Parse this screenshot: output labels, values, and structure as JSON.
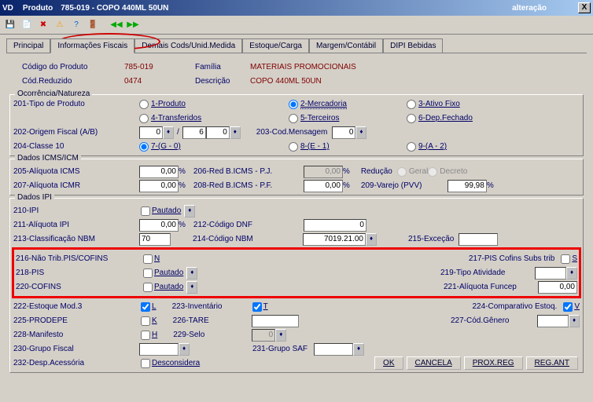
{
  "title": {
    "app": "VD",
    "mod": "Produto",
    "code": "785-019 - COPO 440ML 50UN",
    "mode": "alteração",
    "close": "X"
  },
  "tabs": {
    "t0": "Principal",
    "t1": "Informações Fiscais",
    "t2": "Demais Cods/Unid.Medida",
    "t3": "Estoque/Carga",
    "t4": "Margem/Contábil",
    "t5": "DIPI Bebidas"
  },
  "hdr": {
    "l1": "Código do Produto",
    "v1": "785-019",
    "l2": "Família",
    "v2": "MATERIAIS PROMOCIONAIS",
    "l3": "Cód.Reduzido",
    "v3": "0474",
    "l4": "Descrição",
    "v4": "COPO 440ML 50UN"
  },
  "g1": {
    "title": "Ocorrência/Natureza",
    "f201": "201-Tipo de Produto",
    "o1": "1-Produto",
    "o2": "2-Mercadoria",
    "o3": "3-Ativo Fixo",
    "o4": "4-Transferidos",
    "o5": "5-Terceiros",
    "o6": "6-Dep.Fechado",
    "f202": "202-Origem Fiscal (A/B)",
    "v202a": "0",
    "v202b": "6",
    "v202c": "0",
    "f203": "203-Cod.Mensagem",
    "v203": "0",
    "f204": "204-Classe 10",
    "o7": "7-(G - 0)",
    "o8": "8-(E - 1)",
    "o9": "9-(A - 2)"
  },
  "g2": {
    "title": "Dados ICMS/ICM",
    "f205": "205-Alíquota ICMS",
    "v205": "0,00",
    "pct": "%",
    "f206": "206-Red B.ICMS - P.J.",
    "v206": "0,00",
    "fr": "Redução",
    "og": "Geral",
    "od": "Decreto",
    "f207": "207-Alíquota ICMR",
    "v207": "0,00",
    "f208": "208-Red B.ICMS - P.F.",
    "v208": "0,00",
    "f209": "209-Varejo (PVV)",
    "v209": "99,98"
  },
  "g3": {
    "title": "Dados IPI",
    "f210": "210-IPI",
    "paut": "Pautado",
    "f211": "211-Alíquota IPI",
    "v211": "0,00",
    "f212": "212-Código DNF",
    "v212": "0",
    "f213": "213-Classificação NBM",
    "v213": "70",
    "f214": "214-Código NBM",
    "v214": "7019.21.00",
    "f215": "215-Exceção",
    "v215": ""
  },
  "rb": {
    "f216": "216-Não Trib.PIS/COFINS",
    "n": "N",
    "f217": "217-PIS Cofins Subs trib",
    "s": "S",
    "f218": "218-PIS",
    "f219": "219-Tipo Atividade",
    "v219": "",
    "f220": "220-COFINS",
    "f221": "221-Alíquota Funcep",
    "v221": "0,00"
  },
  "bt": {
    "f222": "222-Estoque Mod.3",
    "l": "L",
    "f223": "223-Inventário",
    "t": "T",
    "f224": "224-Comparativo Estoq.",
    "v": "V",
    "f225": "225-PRODEPE",
    "k": "K",
    "f226": "226-TARE",
    "v226": "",
    "f227": "227-Cód.Gênero",
    "v227": "",
    "f228": "228-Manifesto",
    "h": "H",
    "f229": "229-Selo",
    "v229": "0",
    "f230": "230-Grupo Fiscal",
    "v230": "",
    "f231": "231-Grupo SAF",
    "v231": "",
    "f232": "232-Desp.Acessória",
    "desc": "Desconsidera"
  },
  "btns": {
    "ok": "OK",
    "can": "CANCELA",
    "prox": "PROX.REG",
    "ant": "REG.ANT"
  }
}
